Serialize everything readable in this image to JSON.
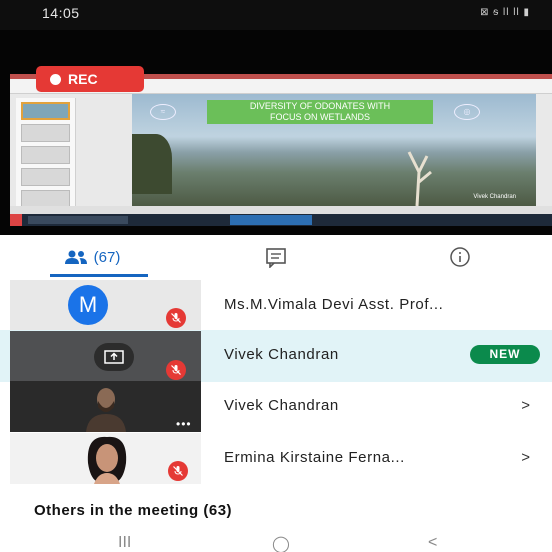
{
  "status_bar": {
    "time": "14:05",
    "indicators": "⊠ ᵴ ll ll ▮"
  },
  "share": {
    "rec_label": "REC",
    "slide_title_line1": "DIVERSITY OF ODONATES WITH",
    "slide_title_line2": "FOCUS ON WETLANDS",
    "slide_credit": "Vivek Chandran"
  },
  "tabs": {
    "people_count": "(67)",
    "active": "people",
    "accent_color": "#1565c0"
  },
  "participants": [
    {
      "name": "Ms.M.Vimala Devi Asst. Prof...",
      "avatar_letter": "M",
      "muted": true
    },
    {
      "name": "Vivek Chandran",
      "badge": "NEW",
      "tile": "screen-share",
      "muted": true
    },
    {
      "name": "Vivek Chandran",
      "action": ">",
      "tile_menu": "•••",
      "muted": false
    },
    {
      "name": "Ermina Kirstaine Ferna...",
      "action": ">",
      "muted": true
    }
  ],
  "others_label": "Others in the meeting (63)",
  "nav": {
    "recents": "III",
    "home": "◯",
    "back": "<"
  },
  "colors": {
    "rec": "#e53935",
    "muted": "#e53935",
    "new_badge": "#0b8a4c",
    "avatar": "#1a73e8",
    "highlight_row": "#e1f3f7"
  }
}
